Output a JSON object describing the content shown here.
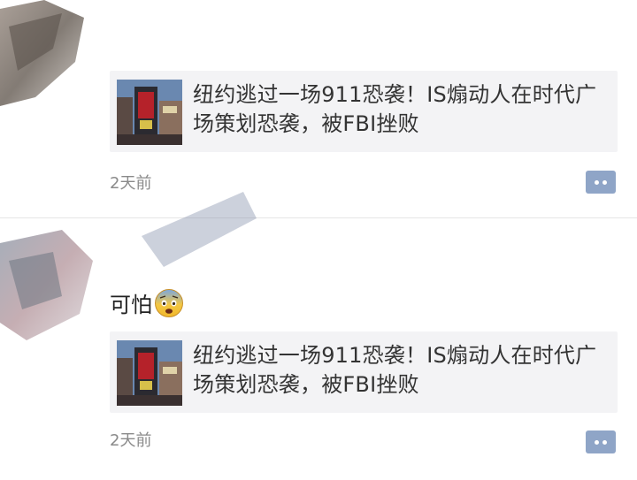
{
  "posts": [
    {
      "caption": "",
      "card_title": "纽约逃过一场911恐袭！IS煽动人在时代广场策划恐袭，被FBI挫败",
      "time": "2天前",
      "thumbnail_icon": "times-square-photo",
      "comment_icon": "comment-icon"
    },
    {
      "caption": "可怕",
      "emoji": "fearful-face-emoji",
      "card_title": "纽约逃过一场911恐袭！IS煽动人在时代广场策划恐袭，被FBI挫败",
      "time": "2天前",
      "thumbnail_icon": "times-square-photo",
      "comment_icon": "comment-icon"
    }
  ],
  "colors": {
    "card_bg": "#f3f3f5",
    "time_text": "#8a8a8a",
    "comment_button": "#8fa5c7",
    "divider": "#e6e6e6"
  }
}
